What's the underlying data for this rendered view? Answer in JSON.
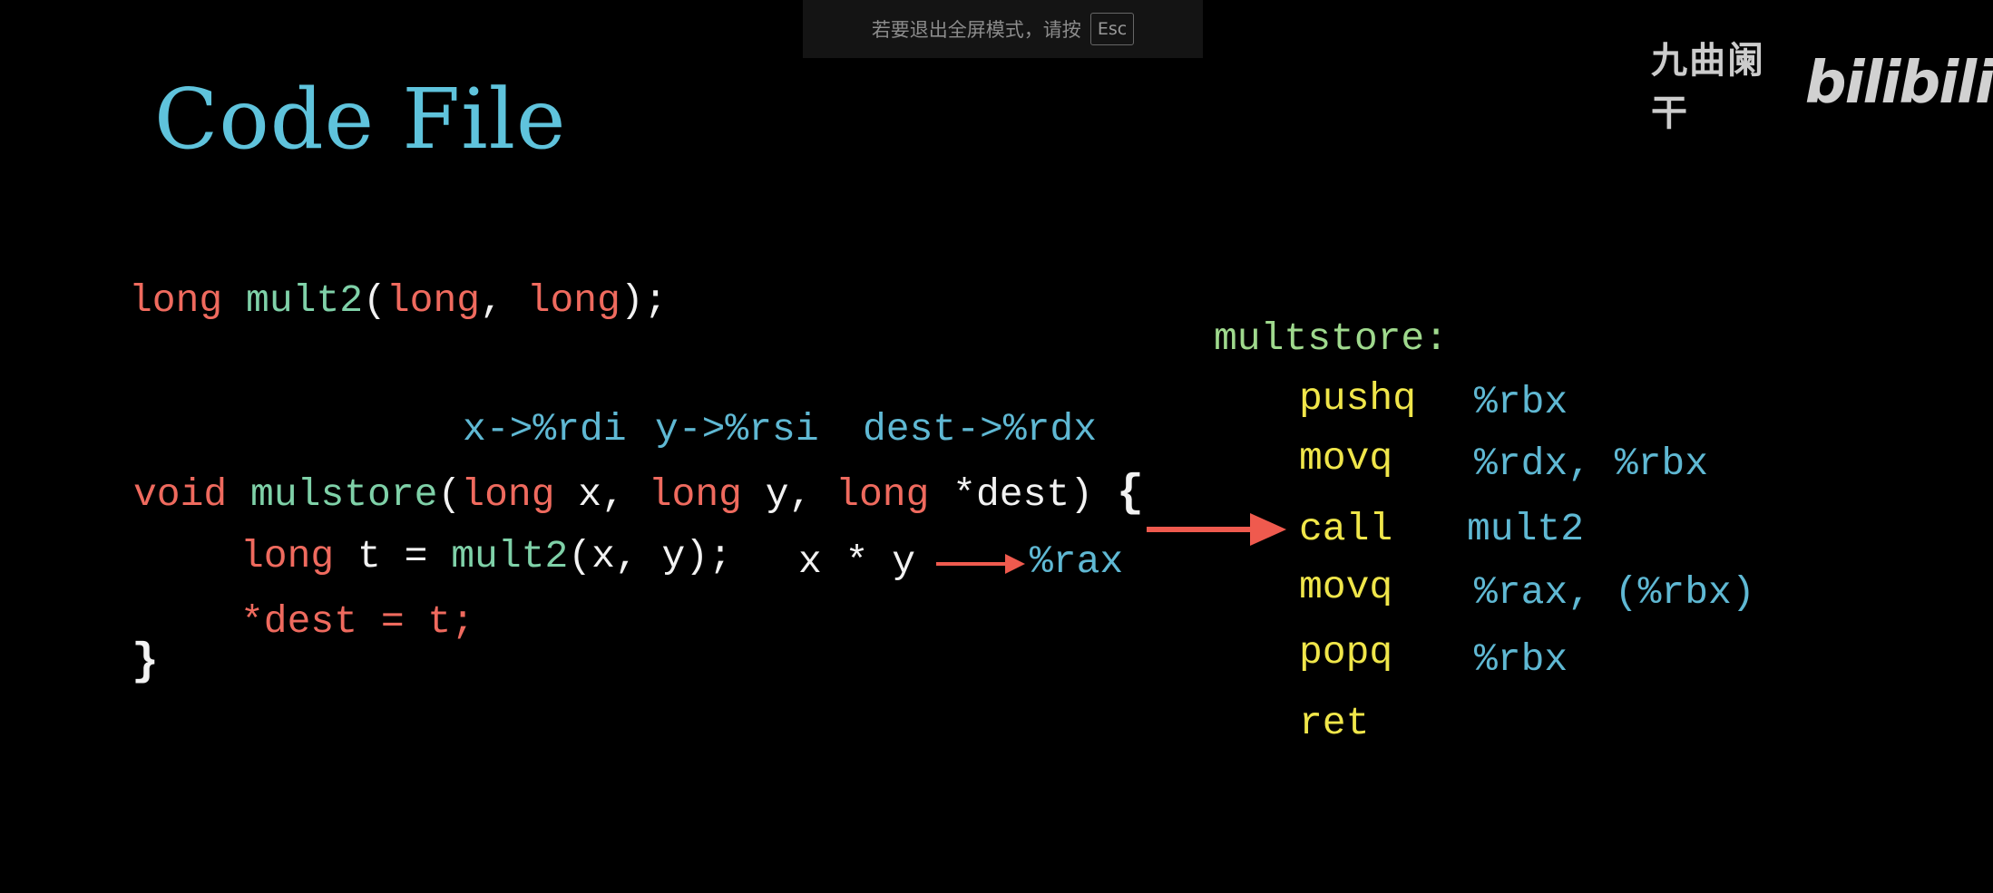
{
  "overlay": {
    "exit_fullscreen_hint": "若要退出全屏模式，请按",
    "exit_key": "Esc"
  },
  "watermark": {
    "uploader": "九曲阑干",
    "logo": "bilibili"
  },
  "slide": {
    "title": "Code File",
    "decl": {
      "ret_type": "long",
      "func": "mult2",
      "open": "(",
      "p1": "long",
      "comma": ", ",
      "p2": "long",
      "close": ");"
    },
    "reg_map": {
      "x": "x->%rdi",
      "y": "y->%rsi",
      "dest": "dest->%rdx"
    },
    "signature": {
      "ret_type": "void",
      "func": "mulstore",
      "open": "(",
      "t1": "long",
      "a1": " x, ",
      "t2": "long",
      "a2": " y, ",
      "t3": "long",
      "a3": " *dest) ",
      "brace_open": "{"
    },
    "body_line1": {
      "type": "long",
      "assign": " t = ",
      "func": "mult2",
      "args": "(x, y);",
      "note": "x * y",
      "result_reg": "%rax"
    },
    "body_line2": "*dest = t;",
    "brace_close": "}",
    "asm": {
      "label": "multstore:",
      "lines": [
        {
          "op": "pushq",
          "args": "%rbx"
        },
        {
          "op": "movq",
          "args": "%rdx, %rbx"
        },
        {
          "op": "call",
          "args": "mult2"
        },
        {
          "op": "movq",
          "args": "%rax, (%rbx)"
        },
        {
          "op": "popq",
          "args": "%rbx"
        },
        {
          "op": "ret",
          "args": ""
        }
      ]
    },
    "colors": {
      "title": "#5fc3dc",
      "keyword": "#ef6a5e",
      "function": "#7fd1a8",
      "register": "#5fb8d3",
      "instruction": "#f0e64a",
      "label": "#9fd98d",
      "arrow": "#ef5a4e"
    }
  }
}
